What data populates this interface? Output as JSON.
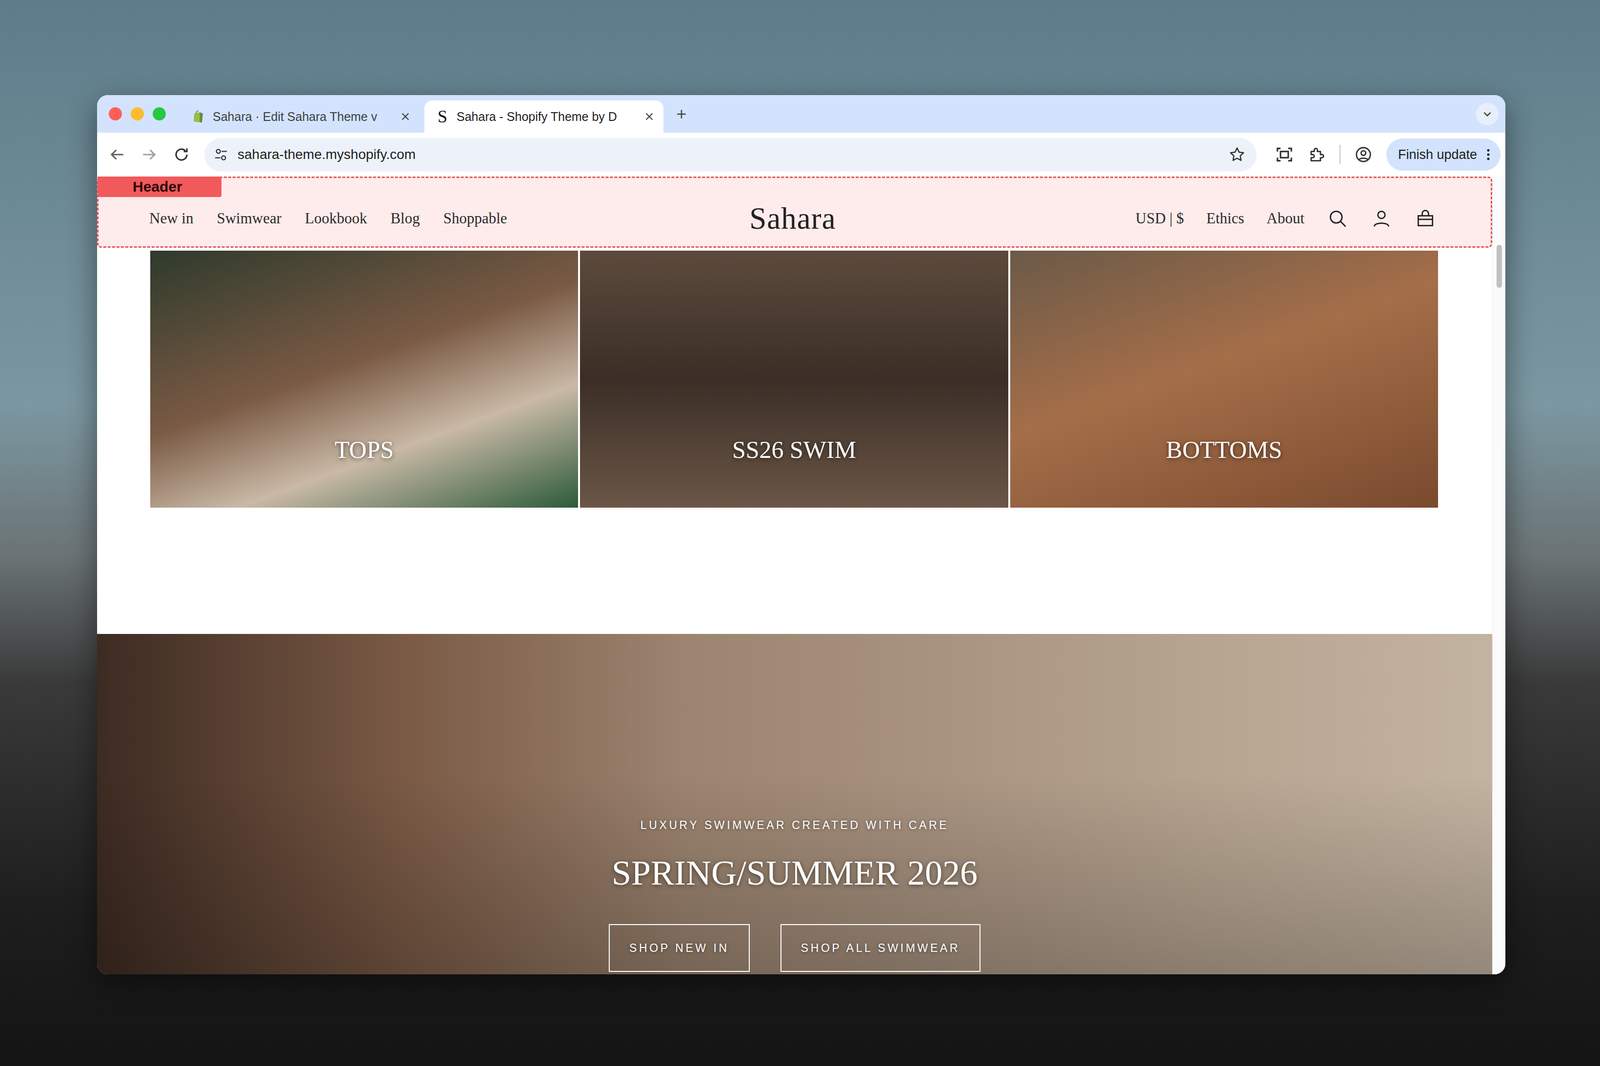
{
  "browser": {
    "tabs": [
      {
        "label": "Sahara · Edit Sahara Theme v",
        "selected": false,
        "favicon": {
          "kind": "shopify",
          "text": ""
        }
      },
      {
        "label": "Sahara - Shopify Theme by D",
        "selected": true,
        "favicon": {
          "kind": "letter",
          "text": "S"
        }
      }
    ],
    "url": "sahara-theme.myshopify.com",
    "update_button": "Finish update",
    "forward_disabled": true
  },
  "editor_overlay": {
    "label": "Header"
  },
  "header": {
    "logo": "Sahara",
    "nav_left": [
      "New in",
      "Swimwear",
      "Lookbook",
      "Blog",
      "Shoppable"
    ],
    "nav_right": [
      "USD | $",
      "Ethics",
      "About"
    ]
  },
  "collections": [
    {
      "label": "TOPS"
    },
    {
      "label": "SS26 SWIM"
    },
    {
      "label": "BOTTOMS"
    }
  ],
  "hero": {
    "eyebrow": "LUXURY SWIMWEAR CREATED WITH CARE",
    "title": "SPRING/SUMMER 2026",
    "buttons": [
      "SHOP NEW IN",
      "SHOP ALL SWIMWEAR"
    ]
  }
}
